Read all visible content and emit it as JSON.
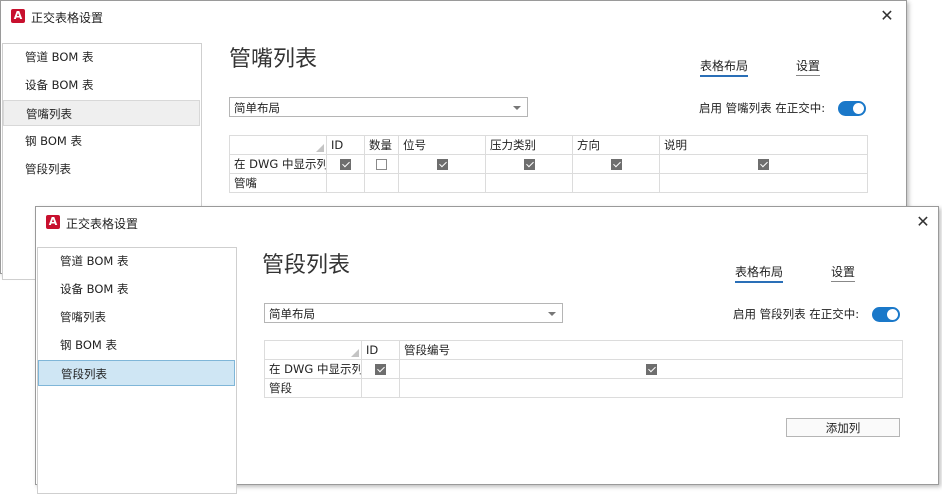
{
  "back_dialog": {
    "title": "正交表格设置",
    "close_glyph": "✕",
    "app_icon_glyph": "A",
    "sidebar": [
      {
        "label": "管道 BOM 表"
      },
      {
        "label": "设备 BOM 表"
      },
      {
        "label": "管嘴列表",
        "selected": true
      },
      {
        "label": "钢 BOM 表"
      },
      {
        "label": "管段列表"
      }
    ],
    "page_title": "管嘴列表",
    "tabs": {
      "layout": "表格布局",
      "settings": "设置"
    },
    "layout_select": "简单布局",
    "enable_label": "启用  管嘴列表 在正交中:",
    "enabled": true,
    "table": {
      "headers": [
        "ID",
        "数量",
        "位号",
        "压力类别",
        "方向",
        "说明"
      ],
      "row_label": "在 DWG 中显示列",
      "checks": [
        true,
        false,
        true,
        true,
        true,
        true
      ],
      "name_row": "管嘴"
    }
  },
  "front_dialog": {
    "title": "正交表格设置",
    "close_glyph": "✕",
    "app_icon_glyph": "A",
    "sidebar": [
      {
        "label": "管道 BOM 表"
      },
      {
        "label": "设备 BOM 表"
      },
      {
        "label": "管嘴列表"
      },
      {
        "label": "钢 BOM 表"
      },
      {
        "label": "管段列表",
        "selected": true
      }
    ],
    "page_title": "管段列表",
    "tabs": {
      "layout": "表格布局",
      "settings": "设置"
    },
    "layout_select": "简单布局",
    "enable_label": "启用  管段列表 在正交中:",
    "enabled": true,
    "table": {
      "headers": [
        "ID",
        "管段编号"
      ],
      "row_label": "在 DWG 中显示列",
      "checks": [
        true,
        true
      ],
      "name_row": "管段"
    },
    "add_column_button": "添加列"
  },
  "colors": {
    "accent": "#1a78c9",
    "brand_icon": "#c8102e",
    "selected_item_blue": "#cfe6f4"
  }
}
